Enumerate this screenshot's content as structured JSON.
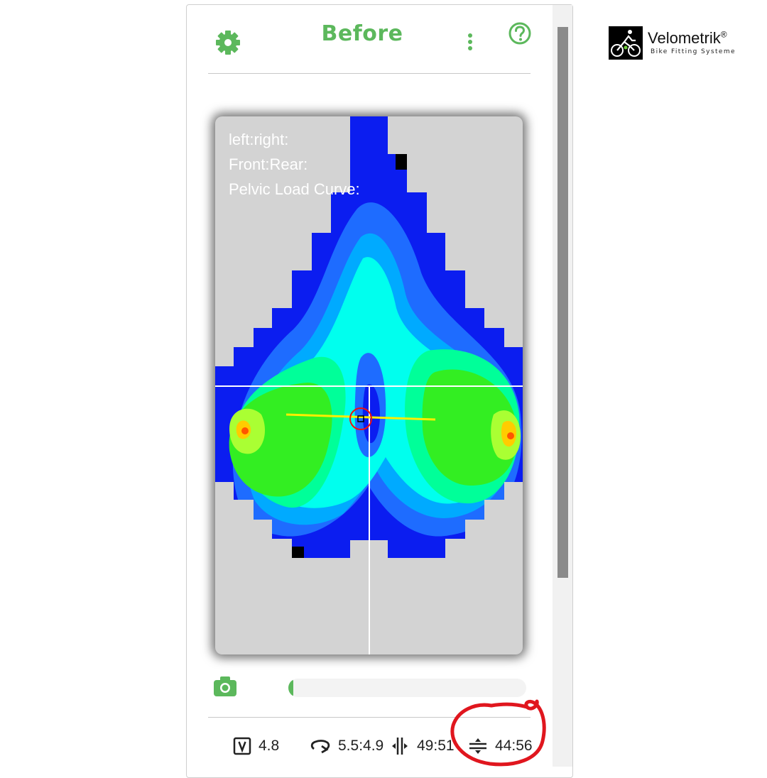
{
  "header": {
    "title": "Before",
    "settings_icon": "gear-icon",
    "menu_icon": "kebab-menu-icon",
    "help_icon": "question-circle-icon"
  },
  "heatmap": {
    "overlay_lines": [
      "left:right:",
      "Front:Rear:",
      "Pelvic Load Curve:"
    ]
  },
  "progress": {
    "camera_icon": "camera-icon",
    "fill_fraction": 0.02
  },
  "stats": {
    "v_value": "4.8",
    "rotation_value": "5.5:4.9",
    "left_right_value": "49:51",
    "front_rear_value": "44:56"
  },
  "brand": {
    "name": "Velometrik",
    "registered": "®",
    "tagline": "Bike Fitting Systeme"
  },
  "colors": {
    "accent": "#5cb85c",
    "annotation": "#e0161e",
    "heatmap_background": "#d3d3d3"
  }
}
